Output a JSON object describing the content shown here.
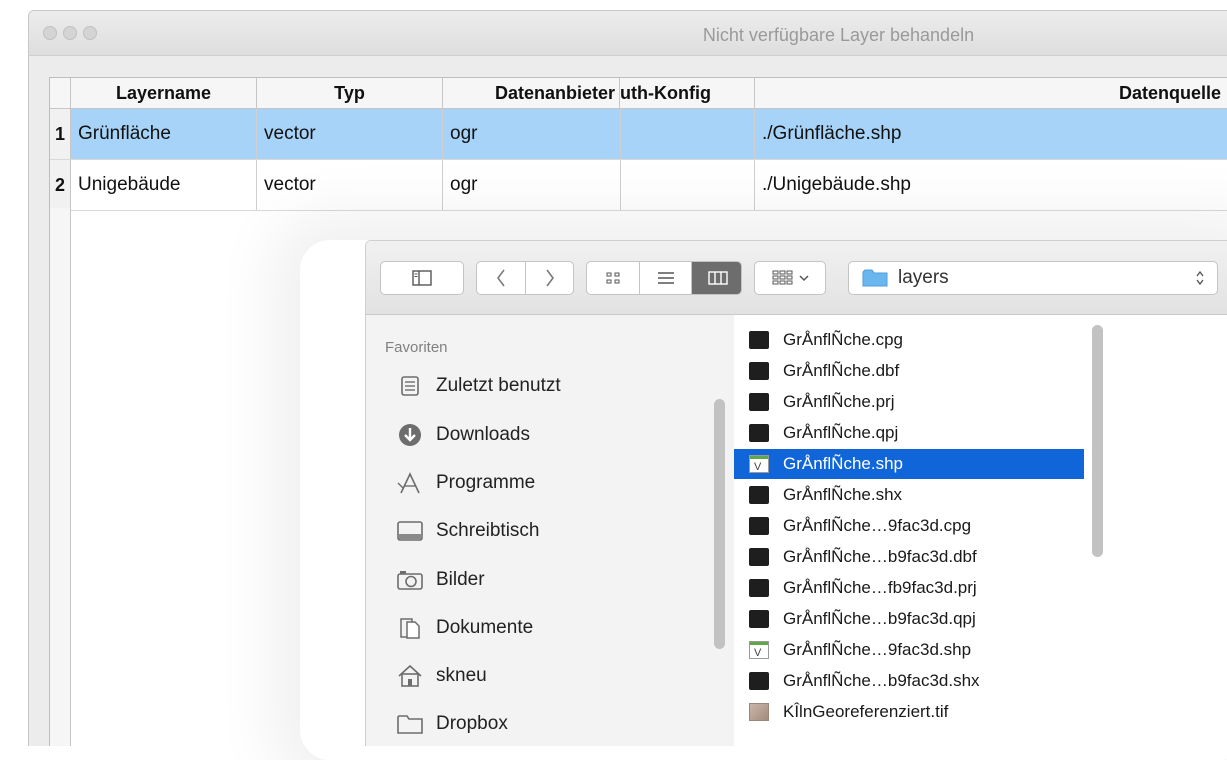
{
  "window": {
    "title": "Nicht verfügbare Layer behandeln"
  },
  "table": {
    "headers": [
      "Layername",
      "Typ",
      "Datenanbieter",
      "Auth-Konfig",
      "Datenquelle"
    ],
    "rows": [
      {
        "num": "1",
        "cells": [
          "Grünfläche",
          "vector",
          "ogr",
          "",
          "./Grünfläche.shp"
        ]
      },
      {
        "num": "2",
        "cells": [
          "Unigebäude",
          "vector",
          "ogr",
          "",
          "./Unigebäude.shp"
        ]
      }
    ]
  },
  "finder": {
    "path_popup": "layers",
    "sidebar_header": "Favoriten",
    "sidebar_items": [
      {
        "label": "Zuletzt benutzt",
        "icon": "recents-icon"
      },
      {
        "label": "Downloads",
        "icon": "downloads-icon"
      },
      {
        "label": "Programme",
        "icon": "applications-icon"
      },
      {
        "label": "Schreibtisch",
        "icon": "desktop-icon"
      },
      {
        "label": "Bilder",
        "icon": "camera-icon"
      },
      {
        "label": "Dokumente",
        "icon": "documents-icon"
      },
      {
        "label": "skneu",
        "icon": "home-icon"
      },
      {
        "label": "Dropbox",
        "icon": "folder-icon"
      }
    ],
    "files": [
      {
        "name": "GrÅnflÑche.cpg",
        "icon": "exec"
      },
      {
        "name": "GrÅnflÑche.dbf",
        "icon": "exec"
      },
      {
        "name": "GrÅnflÑche.prj",
        "icon": "exec"
      },
      {
        "name": "GrÅnflÑche.qpj",
        "icon": "exec"
      },
      {
        "name": "GrÅnflÑche.shp",
        "icon": "qgis",
        "selected": true
      },
      {
        "name": "GrÅnflÑche.shx",
        "icon": "exec"
      },
      {
        "name": "GrÅnflÑche…9fac3d.cpg",
        "icon": "exec"
      },
      {
        "name": "GrÅnflÑche…b9fac3d.dbf",
        "icon": "exec"
      },
      {
        "name": "GrÅnflÑche…fb9fac3d.prj",
        "icon": "exec"
      },
      {
        "name": "GrÅnflÑche…b9fac3d.qpj",
        "icon": "exec"
      },
      {
        "name": "GrÅnflÑche…9fac3d.shp",
        "icon": "qgis"
      },
      {
        "name": "GrÅnflÑche…b9fac3d.shx",
        "icon": "exec"
      },
      {
        "name": "KÎlnGeoreferenziert.tif",
        "icon": "image"
      }
    ]
  },
  "colors": {
    "row_selected": "#a6d3f7",
    "file_selected": "#1066d8"
  }
}
